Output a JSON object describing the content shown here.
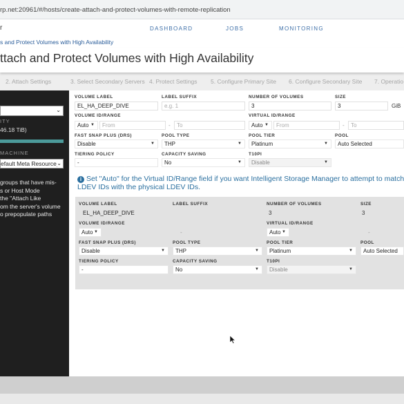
{
  "browser": {
    "url": "rp.net:20961/#/hosts/create-attach-and-protect-volumes-with-remote-replication"
  },
  "topnav": {
    "brand": "r",
    "dashboard": "DASHBOARD",
    "jobs": "JOBS",
    "monitoring": "MONITORING"
  },
  "breadcrumb": "s and Protect Volumes with High Availability",
  "header": {
    "title": "ttach and Protect Volumes with High Availability"
  },
  "steps": [
    {
      "label": "2. Attach Settings"
    },
    {
      "label": "3. Select Secondary Servers"
    },
    {
      "label": "4. Protect Settings"
    },
    {
      "label": "5. Configure Primary Site"
    },
    {
      "label": "6. Configure Secondary Site"
    },
    {
      "label": "7. Operatio"
    }
  ],
  "sidebar": {
    "capacity_label": "ITY",
    "capacity_value": "46.18 TiB)",
    "capacity_fill": 1.0,
    "machine_label": "MACHINE",
    "machine_value": "efault Meta Resource)",
    "note_lines": [
      "groups that have mis-",
      "s or Host Mode",
      "the \"Attach Like",
      "om the server's volume",
      "o prepopulate paths"
    ]
  },
  "primary": {
    "labels": {
      "volume_label": "VOLUME LABEL",
      "label_suffix": "LABEL SUFFIX",
      "number_of_volumes": "NUMBER OF VOLUMES",
      "size": "SIZE",
      "volume_id_range": "VOLUME ID/RANGE",
      "virtual_id_range": "VIRTUAL ID/RANGE",
      "fast_snap": "FAST SNAP PLUS (DRS)",
      "pool_type": "POOL TYPE",
      "pool_tier": "POOL TIER",
      "pool": "POOL",
      "tiering_policy": "TIERING POLICY",
      "capacity_saving": "CAPACITY SAVING",
      "t10pi": "T10PI"
    },
    "values": {
      "volume_label": "EL_HA_DEEP_DIVE",
      "label_suffix_placeholder": "e.g. 1",
      "number_of_volumes": "3",
      "size": "3",
      "size_unit": "GiB",
      "volume_id_mode": "Auto",
      "volume_from_placeholder": "From",
      "volume_to_placeholder": "To",
      "virtual_id_mode": "Auto",
      "virtual_from_placeholder": "From",
      "virtual_to_placeholder": "To",
      "fast_snap": "Disable",
      "pool_type": "THP",
      "pool_tier": "Platinum",
      "pool": "Auto Selected",
      "tiering_policy": "-",
      "capacity_saving": "No",
      "t10pi": "Disable"
    }
  },
  "info": {
    "line1": "Set \"Auto\" for the Virtual ID/Range field if you want Intelligent Storage Manager to attempt to match",
    "line2": "LDEV IDs with the physical LDEV IDs."
  },
  "secondary": {
    "labels": {
      "volume_label": "VOLUME LABEL",
      "label_suffix": "LABEL SUFFIX",
      "number_of_volumes": "NUMBER OF VOLUMES",
      "size": "SIZE",
      "volume_id_range": "VOLUME ID/RANGE",
      "virtual_id_range": "VIRTUAL ID/RANGE",
      "fast_snap": "FAST SNAP PLUS (DRS)",
      "pool_type": "POOL TYPE",
      "pool_tier": "POOL TIER",
      "pool": "POOL",
      "tiering_policy": "TIERING POLICY",
      "capacity_saving": "CAPACITY SAVING",
      "t10pi": "T10PI"
    },
    "values": {
      "volume_label": "EL_HA_DEEP_DIVE",
      "number_of_volumes": "3",
      "size": "3",
      "volume_id_mode": "Auto",
      "volume_dash": "-",
      "virtual_id_mode": "Auto",
      "virtual_dash": "-",
      "fast_snap": "Disable",
      "pool_type": "THP",
      "pool_tier": "Platinum",
      "pool": "Auto Selected",
      "tiering_policy": "-",
      "capacity_saving": "No",
      "t10pi": "Disable"
    }
  },
  "colors": {
    "accent": "#2a6f9f",
    "nav": "#3d6fa8",
    "sidebar": "#1f1f1f",
    "progress": "#4c9a9a"
  }
}
